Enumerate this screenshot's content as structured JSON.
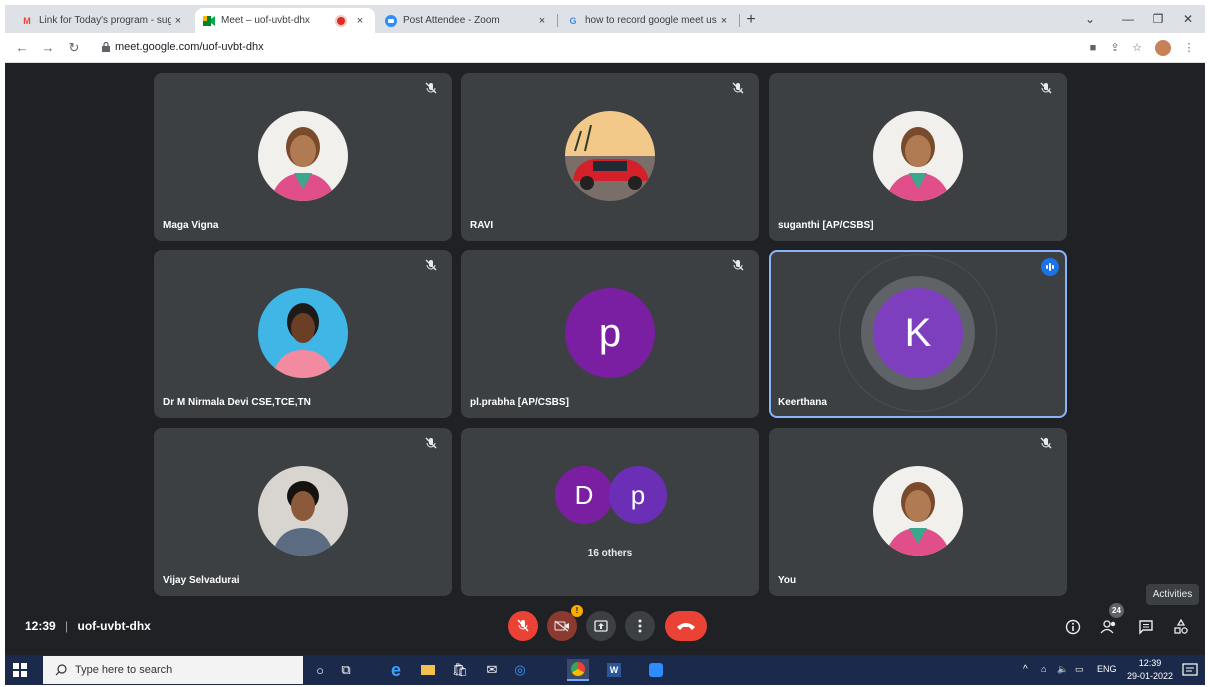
{
  "browser": {
    "tabs": [
      {
        "title": "Link for Today's program - sugan",
        "favicon": "gmail-icon",
        "close": "×"
      },
      {
        "title": "Meet – uof-uvbt-dhx",
        "favicon": "meet-icon",
        "close": "×",
        "recording": true
      },
      {
        "title": "Post Attendee - Zoom",
        "favicon": "zoom-icon",
        "close": "×"
      },
      {
        "title": "how to record google meet using",
        "favicon": "google-icon",
        "close": "×"
      }
    ],
    "new_tab": "+",
    "url": "meet.google.com/uof-uvbt-dhx"
  },
  "participants": [
    {
      "name": "Maga Vigna",
      "muted": true,
      "avatar": "photo-woman"
    },
    {
      "name": "RAVI",
      "muted": true,
      "avatar": "photo-car"
    },
    {
      "name": "suganthi [AP/CSBS]",
      "muted": true,
      "avatar": "photo-woman"
    },
    {
      "name": "Dr M Nirmala Devi CSE,TCE,TN",
      "muted": true,
      "avatar": "photo-woman-2"
    },
    {
      "name": "pl.prabha [AP/CSBS]",
      "muted": true,
      "avatar_letter": "p"
    },
    {
      "name": "Keerthana",
      "speaking": true,
      "avatar_letter": "K"
    },
    {
      "name": "Vijay Selvadurai",
      "muted": true,
      "avatar": "photo-man"
    },
    {
      "others_label": "16 others",
      "avatar_letters": [
        "D",
        "p"
      ]
    },
    {
      "name": "You",
      "muted": true,
      "avatar": "photo-woman"
    }
  ],
  "meeting": {
    "time": "12:39",
    "separator": "|",
    "code": "uof-uvbt-dhx",
    "camera_badge": "!",
    "people_count": "24",
    "tooltip": "Activities"
  },
  "taskbar": {
    "search_placeholder": "Type here to search",
    "tray_lang": "ENG",
    "clock_time": "12:39",
    "clock_date": "29-01-2022"
  },
  "colors": {
    "meet_bg": "#202124",
    "tile_bg": "#3c4043",
    "hangup_red": "#ea4335",
    "speaking_blue": "#8ab4f8",
    "avatar_purple": "#7b1fa2"
  }
}
